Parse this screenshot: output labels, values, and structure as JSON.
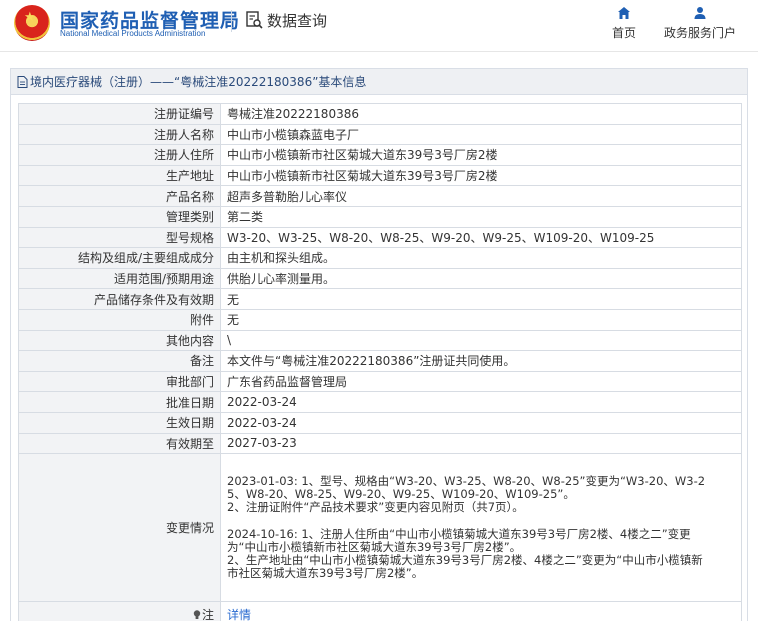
{
  "header": {
    "logo_cn": "国家药品监督管理局",
    "logo_en": "National Medical Products Administration",
    "query_label": "数据查询",
    "nav": [
      {
        "label": "首页",
        "icon": "home-icon"
      },
      {
        "label": "政务服务门户",
        "icon": "user-icon"
      }
    ]
  },
  "panel": {
    "title": "境内医疗器械（注册）——“粤械注准20222180386”基本信息"
  },
  "rows": [
    {
      "key": "注册证编号",
      "value": "粤械注准20222180386"
    },
    {
      "key": "注册人名称",
      "value": "中山市小榄镇森蓝电子厂"
    },
    {
      "key": "注册人住所",
      "value": "中山市小榄镇新市社区菊城大道东39号3号厂房2楼"
    },
    {
      "key": "生产地址",
      "value": "中山市小榄镇新市社区菊城大道东39号3号厂房2楼"
    },
    {
      "key": "产品名称",
      "value": "超声多普勒胎儿心率仪"
    },
    {
      "key": "管理类别",
      "value": "第二类"
    },
    {
      "key": "型号规格",
      "value": "W3-20、W3-25、W8-20、W8-25、W9-20、W9-25、W109-20、W109-25"
    },
    {
      "key": "结构及组成/主要组成成分",
      "value": "由主机和探头组成。"
    },
    {
      "key": "适用范围/预期用途",
      "value": "供胎儿心率测量用。"
    },
    {
      "key": "产品储存条件及有效期",
      "value": "无"
    },
    {
      "key": "附件",
      "value": "无"
    },
    {
      "key": "其他内容",
      "value": "\\"
    },
    {
      "key": "备注",
      "value": "本文件与“粤械注准20222180386”注册证共同使用。"
    },
    {
      "key": "审批部门",
      "value": "广东省药品监督管理局"
    },
    {
      "key": "批准日期",
      "value": "2022-03-24"
    },
    {
      "key": "生效日期",
      "value": "2022-03-24"
    },
    {
      "key": "有效期至",
      "value": "2027-03-23"
    }
  ],
  "change": {
    "key": "变更情况",
    "block1": [
      "2023-01-03: 1、型号、规格由“W3-20、W3-25、W8-20、W8-25”变更为“W3-20、W3-2",
      "5、W8-20、W8-25、W9-20、W9-25、W109-20、W109-25”。",
      "2、注册证附件“产品技术要求”变更内容见附页（共7页）。"
    ],
    "block2": [
      "2024-10-16: 1、注册人住所由“中山市小榄镇菊城大道东39号3号厂房2楼、4楼之二”变更",
      "为“中山市小榄镇新市社区菊城大道东39号3号厂房2楼”。",
      "2、生产地址由“中山市小榄镇菊城大道东39号3号厂房2楼、4楼之二”变更为“中山市小榄镇新",
      "市社区菊城大道东39号3号厂房2楼”。"
    ]
  },
  "note": {
    "key": "注",
    "link": "详情"
  }
}
